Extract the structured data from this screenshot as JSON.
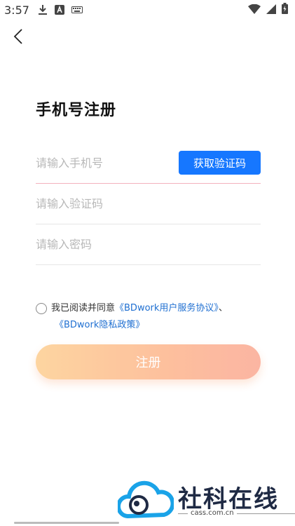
{
  "status_bar": {
    "time": "3:57",
    "icons_left": [
      "download-icon",
      "a-box-icon",
      "keyboard-icon"
    ],
    "icons_right": [
      "wifi-icon",
      "signal-icon",
      "battery-icon"
    ]
  },
  "header": {
    "back_icon": "chevron-left-icon"
  },
  "page": {
    "title": "手机号注册"
  },
  "form": {
    "phone_placeholder": "请输入手机号",
    "get_code_label": "获取验证码",
    "code_placeholder": "请输入验证码",
    "password_placeholder": "请输入密码"
  },
  "agreement": {
    "prefix": "我已阅读并同意",
    "terms_link": "《BDwork用户服务协议》",
    "separator": "、",
    "privacy_link": "《BDwork隐私政策》"
  },
  "register": {
    "label": "注册"
  },
  "watermark": {
    "text": "社科在线",
    "sub": "cass.com.cn"
  },
  "colors": {
    "accent": "#1677ff",
    "link": "#1f6fd1",
    "register_gradient_start": "#fdd39b",
    "register_gradient_end": "#fbb29e"
  }
}
